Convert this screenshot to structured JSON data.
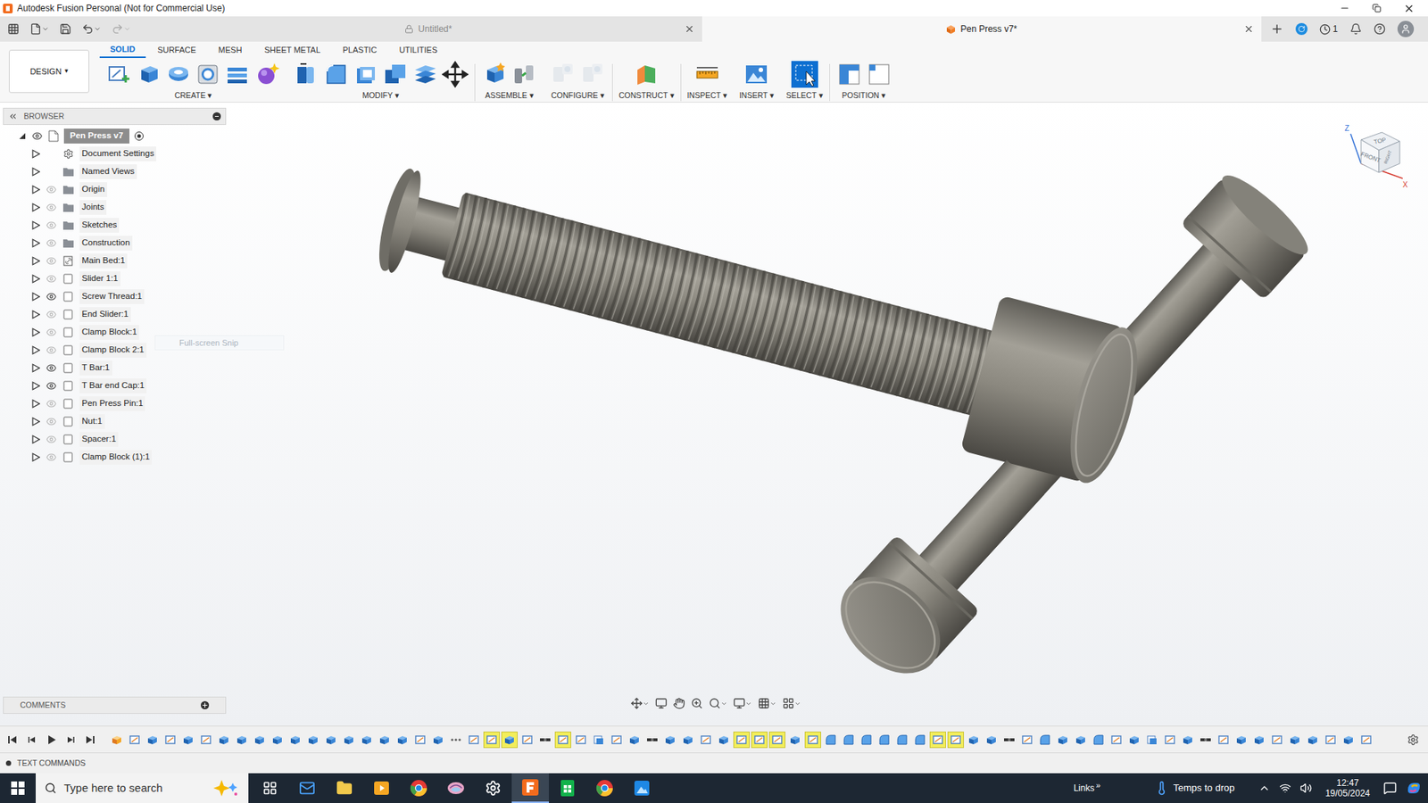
{
  "window": {
    "title": "Autodesk Fusion Personal (Not for Commercial Use)"
  },
  "doc_tabs": [
    {
      "label": "Untitled*",
      "selected": false,
      "locked": true
    },
    {
      "label": "Pen Press v7*",
      "selected": true,
      "locked": false
    }
  ],
  "jobs_count": "1",
  "workspace": {
    "label": "DESIGN",
    "caret": "▾"
  },
  "toolbar_tabs": [
    {
      "label": "SOLID",
      "selected": true
    },
    {
      "label": "SURFACE",
      "selected": false
    },
    {
      "label": "MESH",
      "selected": false
    },
    {
      "label": "SHEET METAL",
      "selected": false
    },
    {
      "label": "PLASTIC",
      "selected": false
    },
    {
      "label": "UTILITIES",
      "selected": false
    }
  ],
  "toolbar_groups": [
    {
      "label": "CREATE",
      "caret": "▾",
      "tools": [
        {
          "kind": "sketch",
          "disabled": false,
          "selected": false
        },
        {
          "kind": "extrude",
          "disabled": false,
          "selected": false
        },
        {
          "kind": "revolve",
          "disabled": false,
          "selected": false
        },
        {
          "kind": "hole",
          "disabled": false,
          "selected": false
        },
        {
          "kind": "pattern",
          "disabled": false,
          "selected": false
        },
        {
          "kind": "form",
          "disabled": false,
          "selected": false
        }
      ]
    },
    {
      "label": "MODIFY",
      "caret": "▾",
      "tools": [
        {
          "kind": "presspull",
          "disabled": false,
          "selected": false
        },
        {
          "kind": "fillet",
          "disabled": false,
          "selected": false
        },
        {
          "kind": "shell",
          "disabled": false,
          "selected": false
        },
        {
          "kind": "combine",
          "disabled": false,
          "selected": false
        },
        {
          "kind": "offset",
          "disabled": false,
          "selected": false
        },
        {
          "kind": "move",
          "disabled": false,
          "selected": false
        }
      ]
    },
    {
      "label": "ASSEMBLE",
      "caret": "▾",
      "tools": [
        {
          "kind": "component",
          "disabled": false,
          "selected": false
        },
        {
          "kind": "joint",
          "disabled": false,
          "selected": false
        }
      ]
    },
    {
      "label": "CONFIGURE",
      "caret": "▾",
      "tools": [
        {
          "kind": "config",
          "disabled": true,
          "selected": false
        },
        {
          "kind": "config",
          "disabled": true,
          "selected": false
        }
      ]
    },
    {
      "label": "CONSTRUCT",
      "caret": "▾",
      "tools": [
        {
          "kind": "plane",
          "disabled": false,
          "selected": false
        }
      ]
    },
    {
      "label": "INSPECT",
      "caret": "▾",
      "tools": [
        {
          "kind": "measure",
          "disabled": false,
          "selected": false
        }
      ]
    },
    {
      "label": "INSERT",
      "caret": "▾",
      "tools": [
        {
          "kind": "image",
          "disabled": false,
          "selected": false
        }
      ]
    },
    {
      "label": "SELECT",
      "caret": "▾",
      "tools": [
        {
          "kind": "select",
          "disabled": false,
          "selected": true
        }
      ]
    },
    {
      "label": "POSITION",
      "caret": "▾",
      "tools": [
        {
          "kind": "position",
          "disabled": false,
          "selected": false
        },
        {
          "kind": "position2",
          "disabled": false,
          "selected": false
        }
      ]
    }
  ],
  "browser": {
    "title": "BROWSER",
    "root": {
      "label": "Pen Press v7",
      "expanded": true,
      "visible": true,
      "selected": true
    },
    "items": [
      {
        "label": "Document Settings",
        "kind": "settings",
        "has_eye": false,
        "expanded": false
      },
      {
        "label": "Named Views",
        "kind": "folder",
        "has_eye": false,
        "expanded": false
      },
      {
        "label": "Origin",
        "kind": "folder",
        "has_eye": true,
        "visible": false,
        "expanded": false
      },
      {
        "label": "Joints",
        "kind": "folder",
        "has_eye": true,
        "visible": false,
        "expanded": false
      },
      {
        "label": "Sketches",
        "kind": "folder",
        "has_eye": true,
        "visible": false,
        "expanded": false
      },
      {
        "label": "Construction",
        "kind": "folder",
        "has_eye": true,
        "visible": false,
        "expanded": false
      },
      {
        "label": "Main Bed:1",
        "kind": "linked",
        "has_eye": true,
        "visible": false,
        "expanded": false
      },
      {
        "label": "Slider 1:1",
        "kind": "component",
        "has_eye": true,
        "visible": false,
        "expanded": false
      },
      {
        "label": "Screw Thread:1",
        "kind": "component",
        "has_eye": true,
        "visible": true,
        "expanded": false
      },
      {
        "label": "End Slider:1",
        "kind": "component",
        "has_eye": true,
        "visible": false,
        "expanded": false
      },
      {
        "label": "Clamp Block:1",
        "kind": "component",
        "has_eye": true,
        "visible": false,
        "expanded": false
      },
      {
        "label": "Clamp Block 2:1",
        "kind": "component",
        "has_eye": true,
        "visible": false,
        "expanded": false
      },
      {
        "label": "T Bar:1",
        "kind": "component",
        "has_eye": true,
        "visible": true,
        "expanded": false
      },
      {
        "label": "T Bar end Cap:1",
        "kind": "component",
        "has_eye": true,
        "visible": true,
        "expanded": false
      },
      {
        "label": "Pen Press Pin:1",
        "kind": "component",
        "has_eye": true,
        "visible": false,
        "expanded": false
      },
      {
        "label": "Nut:1",
        "kind": "component",
        "has_eye": true,
        "visible": false,
        "expanded": false
      },
      {
        "label": "Spacer:1",
        "kind": "component",
        "has_eye": true,
        "visible": false,
        "expanded": false
      },
      {
        "label": "Clamp Block (1):1",
        "kind": "component",
        "has_eye": true,
        "visible": false,
        "expanded": false
      }
    ]
  },
  "ghost_tooltip": "Full-screen Snip",
  "viewcube": {
    "top": "TOP",
    "front": "FRONT",
    "right": "RIGHT",
    "z": "Z",
    "x": "X"
  },
  "comments": {
    "title": "COMMENTS"
  },
  "text_commands": {
    "title": "TEXT COMMANDS"
  },
  "timeline": [
    {
      "kind": "component",
      "highlighted": false
    },
    {
      "kind": "sketch",
      "highlighted": false
    },
    {
      "kind": "extrude",
      "highlighted": false
    },
    {
      "kind": "sketch",
      "highlighted": false
    },
    {
      "kind": "extrude",
      "highlighted": false
    },
    {
      "kind": "sketch",
      "highlighted": false
    },
    {
      "kind": "extrude",
      "highlighted": false
    },
    {
      "kind": "extrude",
      "highlighted": false
    },
    {
      "kind": "extrude",
      "highlighted": false
    },
    {
      "kind": "extrude",
      "highlighted": false
    },
    {
      "kind": "extrude",
      "highlighted": false
    },
    {
      "kind": "extrude",
      "highlighted": false
    },
    {
      "kind": "extrude",
      "highlighted": false
    },
    {
      "kind": "extrude",
      "highlighted": false
    },
    {
      "kind": "extrude",
      "highlighted": false
    },
    {
      "kind": "extrude",
      "highlighted": false
    },
    {
      "kind": "extrude",
      "highlighted": false
    },
    {
      "kind": "sketch",
      "highlighted": false
    },
    {
      "kind": "extrude",
      "highlighted": false
    },
    {
      "kind": "pattern",
      "highlighted": false
    },
    {
      "kind": "sketch",
      "highlighted": false
    },
    {
      "kind": "sketch",
      "highlighted": true
    },
    {
      "kind": "extrude",
      "highlighted": true
    },
    {
      "kind": "sketch",
      "highlighted": false
    },
    {
      "kind": "joint",
      "highlighted": false
    },
    {
      "kind": "sketch",
      "highlighted": true
    },
    {
      "kind": "sketch",
      "highlighted": false
    },
    {
      "kind": "move",
      "highlighted": false
    },
    {
      "kind": "sketch",
      "highlighted": false
    },
    {
      "kind": "extrude",
      "highlighted": false
    },
    {
      "kind": "joint",
      "highlighted": false
    },
    {
      "kind": "extrude",
      "highlighted": false
    },
    {
      "kind": "extrude",
      "highlighted": false
    },
    {
      "kind": "sketch",
      "highlighted": false
    },
    {
      "kind": "extrude",
      "highlighted": false
    },
    {
      "kind": "sketch",
      "highlighted": true
    },
    {
      "kind": "sketch",
      "highlighted": true
    },
    {
      "kind": "sketch",
      "highlighted": true
    },
    {
      "kind": "extrude",
      "highlighted": false
    },
    {
      "kind": "sketch",
      "highlighted": true
    },
    {
      "kind": "fillet",
      "highlighted": false
    },
    {
      "kind": "fillet",
      "highlighted": false
    },
    {
      "kind": "fillet",
      "highlighted": false
    },
    {
      "kind": "fillet",
      "highlighted": false
    },
    {
      "kind": "fillet",
      "highlighted": false
    },
    {
      "kind": "fillet",
      "highlighted": false
    },
    {
      "kind": "sketch",
      "highlighted": true
    },
    {
      "kind": "sketch",
      "highlighted": true
    },
    {
      "kind": "extrude",
      "highlighted": false
    },
    {
      "kind": "extrude",
      "highlighted": false
    },
    {
      "kind": "joint",
      "highlighted": false
    },
    {
      "kind": "sketch",
      "highlighted": false
    },
    {
      "kind": "fillet",
      "highlighted": false
    },
    {
      "kind": "extrude",
      "highlighted": false
    },
    {
      "kind": "extrude",
      "highlighted": false
    },
    {
      "kind": "fillet",
      "highlighted": false
    },
    {
      "kind": "sketch",
      "highlighted": false
    },
    {
      "kind": "extrude",
      "highlighted": false
    },
    {
      "kind": "move",
      "highlighted": false
    },
    {
      "kind": "sketch",
      "highlighted": false
    },
    {
      "kind": "extrude",
      "highlighted": false
    },
    {
      "kind": "joint",
      "highlighted": false
    },
    {
      "kind": "sketch",
      "highlighted": false
    },
    {
      "kind": "extrude",
      "highlighted": false
    },
    {
      "kind": "extrude",
      "highlighted": false
    },
    {
      "kind": "sketch",
      "highlighted": false
    },
    {
      "kind": "extrude",
      "highlighted": false
    },
    {
      "kind": "extrude",
      "highlighted": false
    },
    {
      "kind": "sketch",
      "highlighted": false
    },
    {
      "kind": "extrude",
      "highlighted": false
    },
    {
      "kind": "sketch",
      "highlighted": false
    }
  ],
  "taskbar": {
    "search_placeholder": "Type here to search",
    "apps": [
      {
        "kind": "taskview",
        "active": false
      },
      {
        "kind": "mail",
        "active": false
      },
      {
        "kind": "explorer",
        "active": false
      },
      {
        "kind": "media",
        "active": false
      },
      {
        "kind": "chrome",
        "active": false
      },
      {
        "kind": "brain",
        "active": false
      },
      {
        "kind": "settings",
        "active": false
      },
      {
        "kind": "fusion",
        "active": true
      },
      {
        "kind": "sheets",
        "active": false
      },
      {
        "kind": "chrome",
        "active": false
      },
      {
        "kind": "photos",
        "active": false
      }
    ],
    "links": "Links",
    "chevron": "»",
    "weather": "Temps to drop",
    "time": "12:47",
    "date": "19/05/2024"
  }
}
